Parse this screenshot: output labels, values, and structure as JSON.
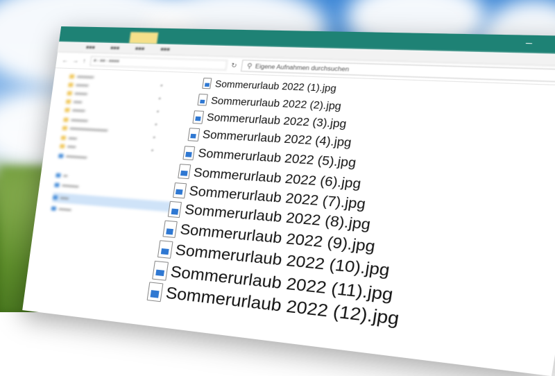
{
  "explorer": {
    "search_placeholder": "Eigene Aufnahmen durchsuchen",
    "files": [
      "Sommerurlaub 2022 (1).jpg",
      "Sommerurlaub 2022 (2).jpg",
      "Sommerurlaub 2022 (3).jpg",
      "Sommerurlaub 2022 (4).jpg",
      "Sommerurlaub 2022 (5).jpg",
      "Sommerurlaub 2022 (6).jpg",
      "Sommerurlaub 2022 (7).jpg",
      "Sommerurlaub 2022 (8).jpg",
      "Sommerurlaub 2022 (9).jpg",
      "Sommerurlaub 2022 (10).jpg",
      "Sommerurlaub 2022 (11).jpg",
      "Sommerurlaub 2022 (12).jpg"
    ]
  },
  "icons": [
    "minimize-icon",
    "maximize-icon",
    "close-icon",
    "help-icon",
    "back-icon",
    "forward-icon",
    "up-icon",
    "refresh-icon",
    "search-icon",
    "image-file-icon",
    "folder-icon",
    "drive-icon",
    "network-icon"
  ],
  "colors": {
    "titlebar": "#1e8275",
    "active_tab": "#f5e08a",
    "selection": "#cfe3f8",
    "file_icon_accent": "#2f78d2"
  }
}
